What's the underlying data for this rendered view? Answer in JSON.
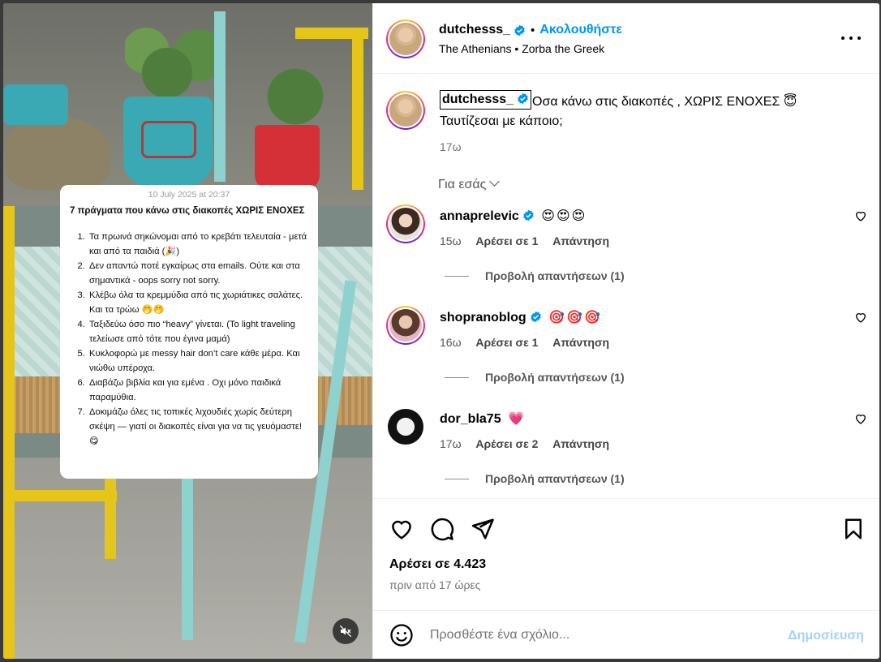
{
  "media": {
    "note_date": "10 July 2025 at 20:37",
    "note_title": "7 πράγματα που κάνω στις διακοπές ΧΩΡΙΣ ΕΝΟΧΕΣ",
    "note_items": [
      "Τα πρωινά σηκώνομαι από το κρεβάτι τελευταία - μετά και από τα παιδιά (🎉)",
      "Δεν απαντώ ποτέ εγκαίρως στα emails. Ούτε και στα σημαντικά - oops sorry not sorry.",
      "Κλέβω όλα τα κρεμμύδια από τις χωριάτικες σαλάτες. Και τα τρώω 🤭🤭",
      "Ταξιδεύω όσο πιο “heavy” γίνεται. (To light traveling τελείωσε από τότε που έγινα μαμά)",
      "Κυκλοφορώ με messy hair don’t care κάθε μέρα. Και νιώθω υπέροχα.",
      "Διαβάζω βιβλία και για εμένα . Οχι μόνο παιδικά παραμύθια.",
      "Δοκιμάζω όλες τις τοπικές λιχουδιές χωρίς δεύτερη σκέψη — γιατί οι διακοπές είναι για να τις γευόμαστε! 😋"
    ],
    "mute_icon": "speaker-muted-icon"
  },
  "header": {
    "username": "dutchesss_",
    "dot": "•",
    "follow_label": "Ακολουθήστε",
    "subtitle": "The Athenians • Zorba the Greek"
  },
  "caption": {
    "username": "dutchesss_",
    "text": "Οσα κάνω στις διακοπές , ΧΩΡΙΣ ΕΝΟΧΕΣ 😇 Ταυτίζεσαι με κάποιο;",
    "time": "17ω"
  },
  "for_you_label": "Για εσάς",
  "comments": [
    {
      "username": "annaprelevic",
      "text": "😍😍😍",
      "time": "15ω",
      "likes": "Αρέσει σε 1",
      "reply": "Απάντηση",
      "view_replies": "Προβολή απαντήσεων (1)",
      "verified": true
    },
    {
      "username": "shopranoblog",
      "text": "🎯🎯🎯",
      "time": "16ω",
      "likes": "Αρέσει σε 1",
      "reply": "Απάντηση",
      "view_replies": "Προβολή απαντήσεων (1)",
      "verified": true
    },
    {
      "username": "dor_bla75",
      "text": "💗",
      "time": "17ω",
      "likes": "Αρέσει σε 2",
      "reply": "Απάντηση",
      "view_replies": "Προβολή απαντήσεων (1)",
      "verified": false
    }
  ],
  "actions": {
    "likes": "Αρέσει σε 4.423",
    "ago": "πριν από 17 ώρες"
  },
  "composer": {
    "placeholder": "Προσθέστε ένα σχόλιο...",
    "post_label": "Δημοσίευση"
  },
  "colors": {
    "accent": "#0095f6",
    "post_disabled": "#a3d3f7",
    "verified": "#0095f6"
  }
}
